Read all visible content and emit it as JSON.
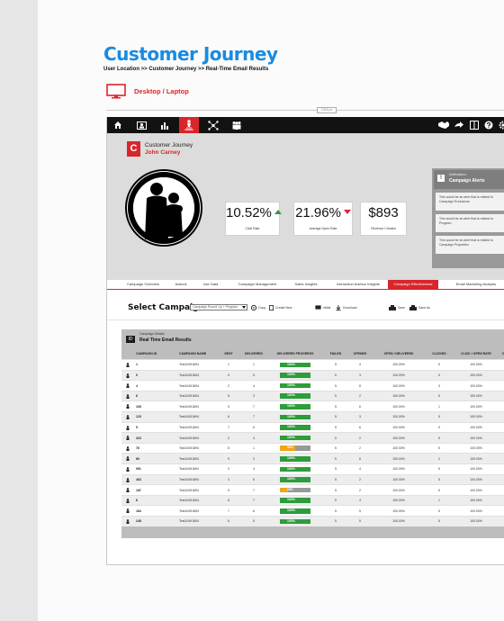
{
  "page": {
    "title": "Customer Journey",
    "breadcrumb": "User Location >> Customer Journey >> Real-Time Email Results",
    "device_label": "Desktop / Laptop",
    "size_tag": "1024 px"
  },
  "colors": {
    "accent": "#d8262b",
    "title_blue": "#1a8be0",
    "nav_bg": "#121212",
    "success": "#2e9c3b",
    "warning": "#f0a31c"
  },
  "nav": {
    "left_icons": [
      "home-icon",
      "id-card-icon",
      "bar-chart-icon",
      "journey-icon",
      "network-icon",
      "users-icon"
    ],
    "active_index": 3,
    "right_icons": [
      "handshake-icon",
      "share-arrow-icon",
      "switch-icon",
      "help-icon",
      "settings-icon"
    ]
  },
  "profile": {
    "logo_letter": "C",
    "title": "Customer Journey",
    "name": "John Carney"
  },
  "kpis": [
    {
      "value": "10.52%",
      "label": "Click Rate",
      "trend": "up"
    },
    {
      "value": "21.96%",
      "label": "Average Open Rate",
      "trend": "down"
    },
    {
      "value": "$893",
      "label": "Revenue Created",
      "trend": "none"
    }
  ],
  "notifications": {
    "icon_label": "!",
    "subtitle": "Notifications",
    "title": "Campaign Alerts",
    "items": [
      "This would be an alert that is related to Campaign Exclusions",
      "This would be an alert that is related to Program",
      "This would be an alert that is related to Campaign Properties"
    ]
  },
  "tabs": [
    "Campaign Overview",
    "Actions",
    "Use Data",
    "Campaign Management",
    "Sales Insights",
    "Interaction Advisor Insights",
    "Campaign Effectiveness",
    "Email Marketing Analysis"
  ],
  "active_tab": 6,
  "selector": {
    "label": "Select Campaign:",
    "value": "Campaign Round Up + Program",
    "actions": [
      "Copy",
      "Create New",
      "xMail",
      "Download",
      "Save",
      "Save As"
    ]
  },
  "panel": {
    "icon_label": "ID",
    "subtitle": "Campaign Details",
    "title": "Real Time Email Results"
  },
  "table": {
    "columns": [
      "CAMPAIGN ID",
      "CAMPAIGN NAME",
      "SENT",
      "DELIVERED",
      "DELIVERED PROGRESS",
      "FAILED",
      "OPENED",
      "OPEN / DELIVERED",
      "CLICKED",
      "CLICK / OPEN RATE",
      "C"
    ],
    "rows": [
      {
        "id": "1",
        "name": "Test10491894",
        "sent": "1",
        "delivered": "1",
        "progress": "100%",
        "pct": 100,
        "failed": "5",
        "opened": "4",
        "open_del": "100.00%",
        "clicked": "5",
        "cor": "100.00%"
      },
      {
        "id": "9",
        "name": "Test10491894",
        "sent": "9",
        "delivered": "5",
        "progress": "100%",
        "pct": 100,
        "failed": "5",
        "opened": "3",
        "open_del": "100.00%",
        "clicked": "5",
        "cor": "100.00%"
      },
      {
        "id": "4",
        "name": "Test10491894",
        "sent": "2",
        "delivered": "4",
        "progress": "100%",
        "pct": 100,
        "failed": "5",
        "opened": "8",
        "open_del": "100.00%",
        "clicked": "3",
        "cor": "100.00%"
      },
      {
        "id": "6",
        "name": "Test10491894",
        "sent": "5",
        "delivered": "3",
        "progress": "100%",
        "pct": 100,
        "failed": "5",
        "opened": "2",
        "open_del": "100.00%",
        "clicked": "5",
        "cor": "100.00%"
      },
      {
        "id": "105",
        "name": "Test10491894",
        "sent": "9",
        "delivered": "7",
        "progress": "100%",
        "pct": 100,
        "failed": "5",
        "opened": "6",
        "open_del": "100.00%",
        "clicked": "1",
        "cor": "100.00%"
      },
      {
        "id": "123",
        "name": "Test10491894",
        "sent": "6",
        "delivered": "7",
        "progress": "100%",
        "pct": 100,
        "failed": "5",
        "opened": "3",
        "open_del": "100.00%",
        "clicked": "5",
        "cor": "100.00%"
      },
      {
        "id": "5",
        "name": "Test10491894",
        "sent": "7",
        "delivered": "6",
        "progress": "100%",
        "pct": 100,
        "failed": "5",
        "opened": "6",
        "open_del": "100.00%",
        "clicked": "9",
        "cor": "100.00%"
      },
      {
        "id": "323",
        "name": "Test10491894",
        "sent": "2",
        "delivered": "4",
        "progress": "100%",
        "pct": 100,
        "failed": "5",
        "opened": "2",
        "open_del": "100.00%",
        "clicked": "5",
        "cor": "100.00%"
      },
      {
        "id": "76",
        "name": "Test10491894",
        "sent": "5",
        "delivered": "1",
        "progress": "50%",
        "pct": 50,
        "failed": "5",
        "opened": "2",
        "open_del": "100.00%",
        "clicked": "5",
        "cor": "100.00%"
      },
      {
        "id": "89",
        "name": "Test10491894",
        "sent": "9",
        "delivered": "3",
        "progress": "100%",
        "pct": 100,
        "failed": "5",
        "opened": "6",
        "open_del": "100.00%",
        "clicked": "2",
        "cor": "100.00%"
      },
      {
        "id": "951",
        "name": "Test10491894",
        "sent": "2",
        "delivered": "4",
        "progress": "100%",
        "pct": 100,
        "failed": "5",
        "opened": "4",
        "open_del": "100.00%",
        "clicked": "5",
        "cor": "100.00%"
      },
      {
        "id": "463",
        "name": "Test10491894",
        "sent": "4",
        "delivered": "6",
        "progress": "100%",
        "pct": 100,
        "failed": "5",
        "opened": "2",
        "open_del": "100.00%",
        "clicked": "5",
        "cor": "100.00%"
      },
      {
        "id": "187",
        "name": "Test10491894",
        "sent": "9",
        "delivered": "7",
        "progress": "25%",
        "pct": 25,
        "failed": "5",
        "opened": "2",
        "open_del": "100.00%",
        "clicked": "5",
        "cor": "100.00%"
      },
      {
        "id": "8",
        "name": "Test10491894",
        "sent": "6",
        "delivered": "7",
        "progress": "100%",
        "pct": 100,
        "failed": "5",
        "opened": "4",
        "open_del": "100.00%",
        "clicked": "1",
        "cor": "100.00%"
      },
      {
        "id": "184",
        "name": "Test10491894",
        "sent": "7",
        "delivered": "6",
        "progress": "100%",
        "pct": 100,
        "failed": "5",
        "opened": "5",
        "open_del": "100.00%",
        "clicked": "5",
        "cor": "100.00%"
      },
      {
        "id": "248",
        "name": "Test10491894",
        "sent": "5",
        "delivered": "5",
        "progress": "100%",
        "pct": 100,
        "failed": "5",
        "opened": "5",
        "open_del": "100.00%",
        "clicked": "5",
        "cor": "100.00%"
      }
    ]
  }
}
